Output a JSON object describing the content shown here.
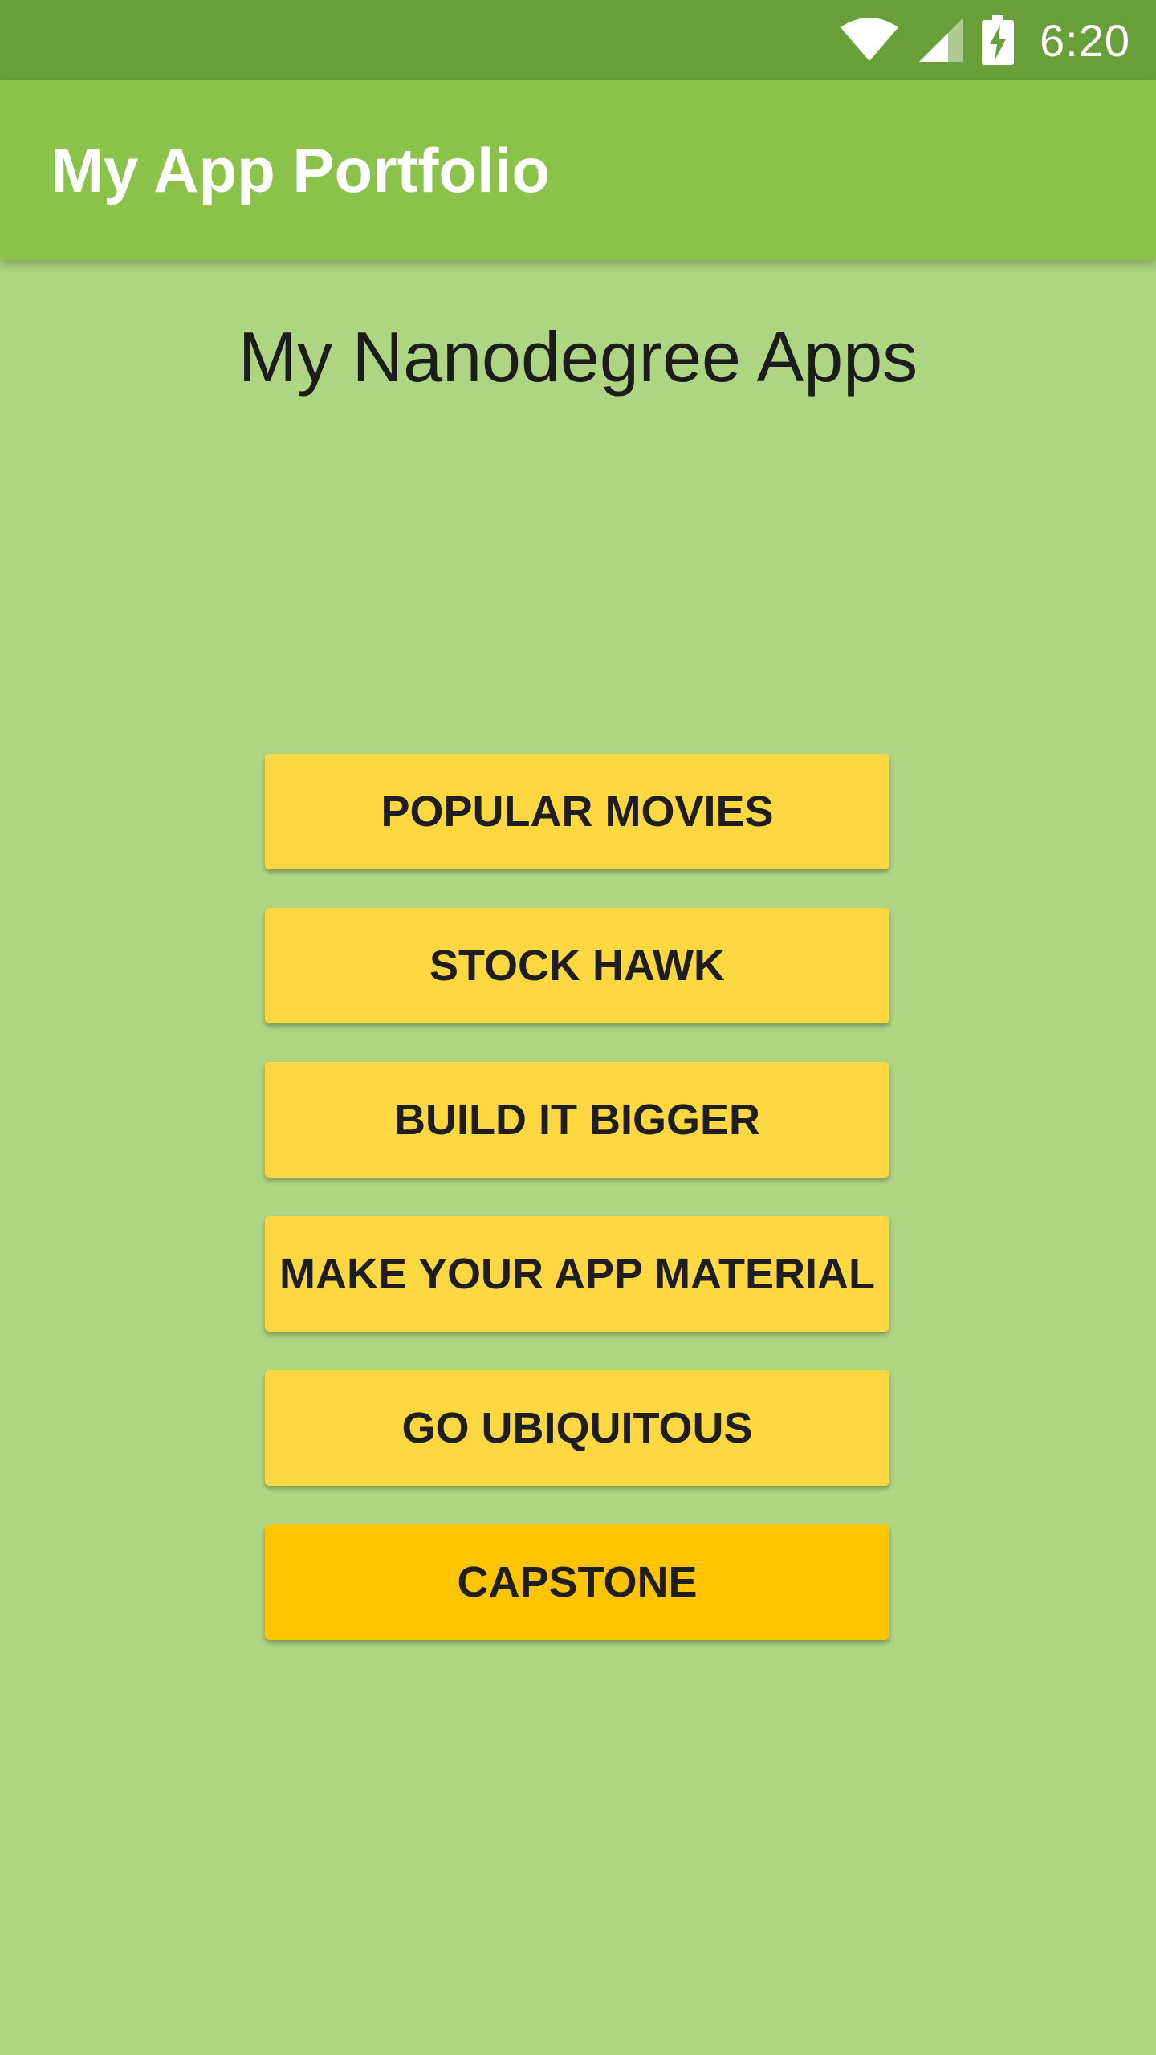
{
  "status_bar": {
    "time": "6:20",
    "icons": [
      "wifi-icon",
      "cell-signal-icon",
      "battery-charging-icon"
    ]
  },
  "app_bar": {
    "title": "My App Portfolio"
  },
  "main": {
    "heading": "My Nanodegree Apps",
    "buttons": [
      {
        "label": "POPULAR MOVIES"
      },
      {
        "label": "STOCK HAWK"
      },
      {
        "label": "BUILD IT BIGGER"
      },
      {
        "label": "MAKE YOUR APP MATERIAL"
      },
      {
        "label": "GO UBIQUITOUS"
      },
      {
        "label": "CAPSTONE"
      }
    ]
  },
  "colors": {
    "status_bar": "#689F38",
    "app_bar": "#8BC34A",
    "background": "#AED581",
    "button": "#FFD740",
    "button_accent": "#FFC400"
  }
}
